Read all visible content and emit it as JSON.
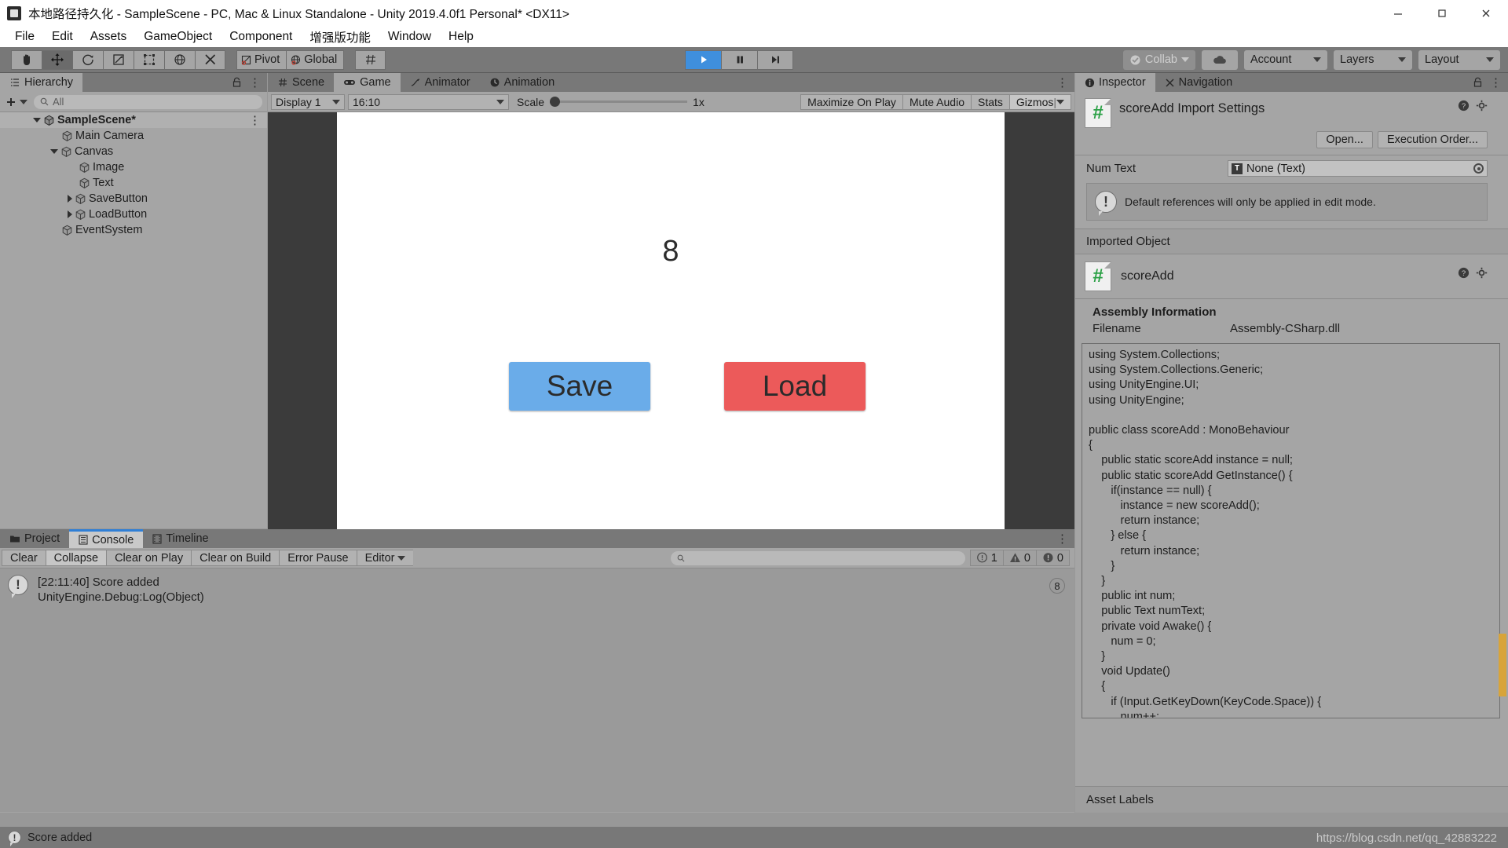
{
  "window": {
    "title": "本地路径持久化 - SampleScene - PC, Mac & Linux Standalone - Unity 2019.4.0f1 Personal* <DX11>",
    "minimize": "minimize-icon",
    "maximize": "maximize-icon",
    "close": "close-icon"
  },
  "menubar": {
    "items": [
      "File",
      "Edit",
      "Assets",
      "GameObject",
      "Component",
      "增强版功能",
      "Window",
      "Help"
    ]
  },
  "toolbar": {
    "tools": [
      "hand-tool",
      "move-tool",
      "rotate-tool",
      "scale-tool",
      "rect-tool",
      "transform-tool",
      "custom-tool"
    ],
    "pivot_label": "Pivot",
    "global_label": "Global",
    "grid_label": "grid-snap-icon",
    "play": "play-icon",
    "pause": "pause-icon",
    "step": "step-icon",
    "collab_label": "Collab",
    "cloud_label": "cloud-icon",
    "account_label": "Account",
    "layers_label": "Layers",
    "layout_label": "Layout"
  },
  "hierarchy": {
    "tab_label": "Hierarchy",
    "tab_icon": "hierarchy-icon",
    "create_label": "+",
    "search_placeholder": "All",
    "rows": [
      {
        "label": "SampleScene*",
        "depth": 0,
        "twisty": "down",
        "icon": "scene-icon",
        "selected": true
      },
      {
        "label": "Main Camera",
        "depth": 1,
        "twisty": "none",
        "icon": "gameobject-icon",
        "selected": false
      },
      {
        "label": "Canvas",
        "depth": 1,
        "twisty": "down",
        "icon": "gameobject-icon",
        "selected": false
      },
      {
        "label": "Image",
        "depth": 2,
        "twisty": "none",
        "icon": "gameobject-icon",
        "selected": false
      },
      {
        "label": "Text",
        "depth": 2,
        "twisty": "none",
        "icon": "gameobject-icon",
        "selected": false
      },
      {
        "label": "SaveButton",
        "depth": 2,
        "twisty": "right",
        "icon": "gameobject-icon",
        "selected": false
      },
      {
        "label": "LoadButton",
        "depth": 2,
        "twisty": "right",
        "icon": "gameobject-icon",
        "selected": false
      },
      {
        "label": "EventSystem",
        "depth": 1,
        "twisty": "none",
        "icon": "gameobject-icon",
        "selected": false
      }
    ]
  },
  "gameview": {
    "tabs": [
      {
        "label": "Scene",
        "icon": "scene-tab-icon",
        "active": false
      },
      {
        "label": "Game",
        "icon": "game-tab-icon",
        "active": true
      },
      {
        "label": "Animator",
        "icon": "animator-tab-icon",
        "active": false
      },
      {
        "label": "Animation",
        "icon": "animation-tab-icon",
        "active": false
      }
    ],
    "display": "Display 1",
    "aspect": "16:10",
    "scale_label": "Scale",
    "scale_value": "1x",
    "maximize_on_play": "Maximize On Play",
    "mute_audio": "Mute Audio",
    "stats": "Stats",
    "gizmos": "Gizmos",
    "stage": {
      "score": "8",
      "save_button": "Save",
      "load_button": "Load",
      "save_color": "#6aace9",
      "load_color": "#ec5a5a",
      "background": "#ffffff"
    }
  },
  "inspector": {
    "tabs": [
      {
        "label": "Inspector",
        "icon": "inspector-icon",
        "active": true
      },
      {
        "label": "Navigation",
        "icon": "navigation-icon",
        "active": false
      }
    ],
    "import_title": "scoreAdd Import Settings",
    "open_button": "Open...",
    "execution_order_button": "Execution Order...",
    "num_text_label": "Num Text",
    "num_text_value": "None (Text)",
    "num_text_type_badge": "T",
    "helpbox": "Default references will only be applied in edit mode.",
    "imported_object_header": "Imported Object",
    "imported_object_name": "scoreAdd",
    "assembly_title": "Assembly Information",
    "assembly_filename_label": "Filename",
    "assembly_filename_value": "Assembly-CSharp.dll",
    "asset_labels": "Asset Labels",
    "code": "using System.Collections;\nusing System.Collections.Generic;\nusing UnityEngine.UI;\nusing UnityEngine;\n\npublic class scoreAdd : MonoBehaviour\n{\n    public static scoreAdd instance = null;\n    public static scoreAdd GetInstance() {\n       if(instance == null) {\n          instance = new scoreAdd();\n          return instance;\n       } else {\n          return instance;\n       }\n    }\n    public int num;\n    public Text numText;\n    private void Awake() {\n       num = 0;\n    }\n    void Update()\n    {\n       if (Input.GetKeyDown(KeyCode.Space)) {\n          num++;\n          Debug.Log(\"Score added\");\n          numText.text = num.ToString();\n       }\n    }\n}"
  },
  "console": {
    "tabs": [
      {
        "label": "Project",
        "icon": "project-icon",
        "active": false
      },
      {
        "label": "Console",
        "icon": "console-icon",
        "active": true
      },
      {
        "label": "Timeline",
        "icon": "timeline-icon",
        "active": false
      }
    ],
    "buttons": [
      "Clear",
      "Collapse",
      "Clear on Play",
      "Clear on Build",
      "Error Pause"
    ],
    "collapse_on": true,
    "editor_dropdown": "Editor",
    "search_placeholder": "",
    "counts": {
      "info": "1",
      "warning": "0",
      "error": "0"
    },
    "entries": [
      {
        "line1": "[22:11:40] Score added",
        "line2": "UnityEngine.Debug:Log(Object)",
        "badge": "8",
        "icon": "info-icon"
      }
    ]
  },
  "statusbar": {
    "icon": "info-icon",
    "text": "Score added",
    "watermark": "https://blog.csdn.net/qq_42883222"
  }
}
